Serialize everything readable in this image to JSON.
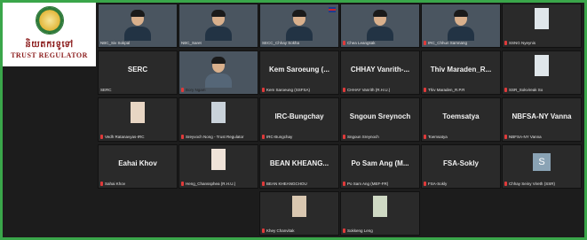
{
  "logo": {
    "khmer_text": "និយតករទូទៅ",
    "english_text": "TRUST REGULATOR"
  },
  "colors": {
    "frame": "#3aa64a",
    "tile_bg": "#2a2a2a",
    "mic_muted": "#e03a3a"
  },
  "tiles": [
    {
      "title": "",
      "caption": "NBC_Siv Sokpal",
      "muted": false
    },
    {
      "title": "",
      "caption": "NBC_Saret",
      "muted": false
    },
    {
      "title": "",
      "caption": "SECC_Chhay Sokha",
      "muted": false
    },
    {
      "title": "",
      "caption": "Chea Leangsak",
      "muted": true
    },
    {
      "title": "",
      "caption": "IRC_Chhun Samnang",
      "muted": true
    },
    {
      "title": "",
      "caption": "SSNG Nyeynis",
      "muted": true
    },
    {
      "title": "SERC",
      "caption": "SERC",
      "muted": false
    },
    {
      "title": "",
      "caption": "Bory Ngam",
      "muted": true
    },
    {
      "title": "Kem Saroeung (...",
      "caption": "Kem Saroeung (SSFSA)",
      "muted": true
    },
    {
      "title": "CHHAY Vanrith-...",
      "caption": "CHHAY Vanrith (R.H.U.)",
      "muted": true
    },
    {
      "title": "Thiv Maraden_R...",
      "caption": "Thiv Maraden_R.P.R",
      "muted": true
    },
    {
      "title": "",
      "caption": "SSR_Sokvireak So",
      "muted": true
    },
    {
      "title": "",
      "caption": "Vedh Ratanavyas-IRC",
      "muted": true
    },
    {
      "title": "",
      "caption": "Sreyvoch Nong - Trust Regulator",
      "muted": true
    },
    {
      "title": "IRC-Bungchay",
      "caption": "IRC-Bungchay",
      "muted": true
    },
    {
      "title": "Sngoun Sreynoch",
      "caption": "Sngoun Sreynoch",
      "muted": true
    },
    {
      "title": "Toemsatya",
      "caption": "Toemsatya",
      "muted": true
    },
    {
      "title": "NBFSA-NY Vanna",
      "caption": "NBFSA-NY Vanna",
      "muted": true
    },
    {
      "title": "Eahai Khov",
      "caption": "Sahai Khov",
      "muted": true
    },
    {
      "title": "",
      "caption": "Heng_Chanssphea (R.H.U.)",
      "muted": true
    },
    {
      "title": "BEAN KHEANG...",
      "caption": "BEAN KHEANGCHOU",
      "muted": true
    },
    {
      "title": "Po Sam Ang (M...",
      "caption": "Po Sam Ang (MEF-FR)",
      "muted": true
    },
    {
      "title": "FSA-Sokly",
      "caption": "FSA-Sokly",
      "muted": true
    },
    {
      "title": "",
      "caption": "Chhay Seiny Vireth (SSR)",
      "muted": true,
      "avatar_letter": "S"
    },
    {
      "title": "",
      "caption": "Khey Chanvitak",
      "muted": true
    },
    {
      "title": "",
      "caption": "Sokkeng Leng",
      "muted": true
    }
  ]
}
